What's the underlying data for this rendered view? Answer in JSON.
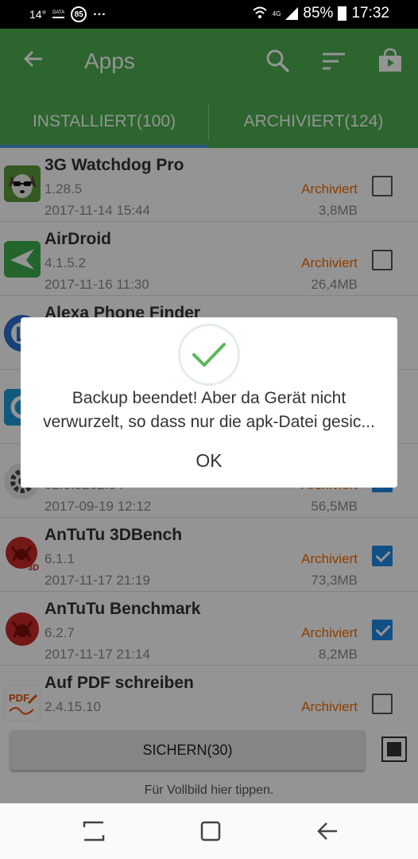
{
  "status_bar": {
    "temperature": "14°",
    "data_label": "DATA",
    "badge": "85",
    "dots": "...",
    "network": "4G",
    "battery": "85%",
    "time": "17:32"
  },
  "app_bar": {
    "title": "Apps",
    "icons": [
      "back-arrow-icon",
      "search-icon",
      "sort-icon",
      "shopping-bag-icon"
    ]
  },
  "tabs": [
    {
      "label": "INSTALLIERT(100)",
      "selected": true
    },
    {
      "label": "ARCHIVIERT(124)",
      "selected": false
    }
  ],
  "apps": [
    {
      "name": "3G Watchdog Pro",
      "version": "1.28.5",
      "date": "2017-11-14 15:44",
      "status": "Archiviert",
      "size": "3,8MB",
      "checked": false,
      "icon": "watchdog-icon"
    },
    {
      "name": "AirDroid",
      "version": "4.1.5.2",
      "date": "2017-11-16 11:30",
      "status": "Archiviert",
      "size": "26,4MB",
      "checked": false,
      "icon": "airdroid-icon"
    },
    {
      "name": "Alexa Phone Finder",
      "version": "",
      "date": "",
      "status": "",
      "size": "",
      "checked": false,
      "icon": "alexa-icon"
    },
    {
      "name": "",
      "version": "",
      "date": "",
      "status": "",
      "size": "",
      "checked": false,
      "icon": "app-icon"
    },
    {
      "name": "",
      "version": "02.0.3202.04",
      "date": "2017-09-19 12:12",
      "status": "Archiviert",
      "size": "56,5MB",
      "checked": true,
      "icon": "settings-gear-icon"
    },
    {
      "name": "AnTuTu 3DBench",
      "version": "6.1.1",
      "date": "2017-11-17 21:19",
      "status": "Archiviert",
      "size": "73,3MB",
      "checked": true,
      "icon": "antutu-3d-icon"
    },
    {
      "name": "AnTuTu Benchmark",
      "version": "6.2.7",
      "date": "2017-11-17 21:14",
      "status": "Archiviert",
      "size": "8,2MB",
      "checked": true,
      "icon": "antutu-icon"
    },
    {
      "name": "Auf PDF schreiben",
      "version": "2.4.15.10",
      "date": "",
      "status": "Archiviert",
      "size": "",
      "checked": false,
      "icon": "pdf-icon"
    }
  ],
  "backup_button": "SICHERN(30)",
  "fullscreen_hint": "Für Vollbild hier tippen.",
  "dialog": {
    "message_line1": "Backup beendet! Aber da Gerät nicht",
    "message_line2": "verwurzelt, so dass nur die apk-Datei gesic...",
    "ok_label": "OK"
  },
  "colors": {
    "app_bar": "#4caf50",
    "archived_text": "#ef6c00",
    "checkbox_checked": "#1e88e5",
    "tab_indicator": "#3e9ad6"
  }
}
